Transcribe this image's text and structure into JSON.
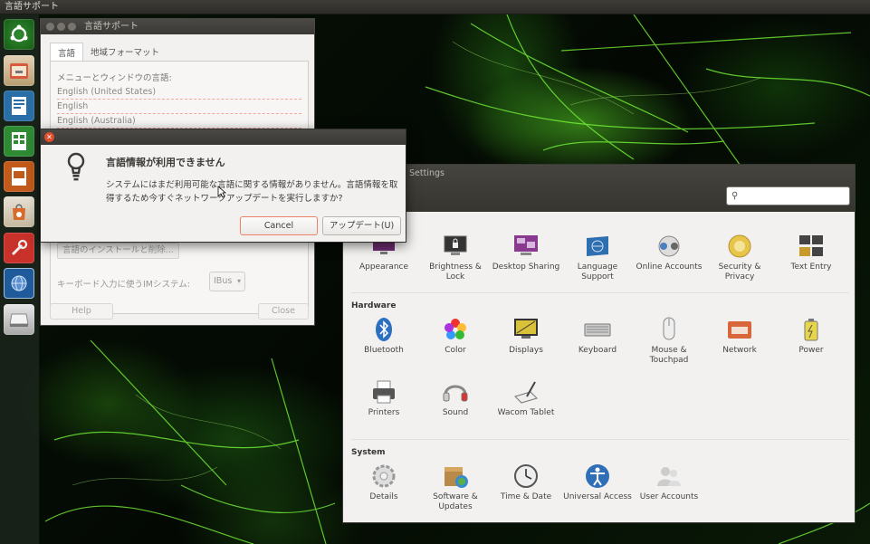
{
  "top_panel": {
    "title": "言語サポート"
  },
  "language_window": {
    "title": "言語サポート",
    "tabs": [
      {
        "label": "言語"
      },
      {
        "label": "地域フォーマット"
      }
    ],
    "menu_language_label": "メニューとウィンドウの言語:",
    "languages": [
      "English (United States)",
      "English",
      "English (Australia)"
    ],
    "install_button": "言語のインストールと削除...",
    "im_label": "キーボード入力に使うIMシステム:",
    "im_value": "IBus",
    "help_button": "Help",
    "close_button": "Close"
  },
  "dialog": {
    "heading": "言語情報が利用できません",
    "body": "システムにはまだ利用可能な言語に関する情報がありません。言語情報を取得するため今すぐネットワークアップデートを実行しますか?",
    "cancel_label": "Cancel",
    "update_label": "アップデート(U)"
  },
  "settings_window": {
    "title": "Settings",
    "search_placeholder": "",
    "personal_items": [
      {
        "label": "Appearance",
        "icon": "appearance-icon"
      },
      {
        "label": "Brightness & Lock",
        "icon": "brightness-lock-icon"
      },
      {
        "label": "Desktop Sharing",
        "icon": "desktop-sharing-icon"
      },
      {
        "label": "Language Support",
        "icon": "language-support-icon"
      },
      {
        "label": "Online Accounts",
        "icon": "online-accounts-icon"
      },
      {
        "label": "Security & Privacy",
        "icon": "security-privacy-icon"
      },
      {
        "label": "Text Entry",
        "icon": "text-entry-icon"
      }
    ],
    "hardware_title": "Hardware",
    "hardware_items": [
      {
        "label": "Bluetooth",
        "icon": "bluetooth-icon"
      },
      {
        "label": "Color",
        "icon": "color-icon"
      },
      {
        "label": "Displays",
        "icon": "displays-icon"
      },
      {
        "label": "Keyboard",
        "icon": "keyboard-icon"
      },
      {
        "label": "Mouse & Touchpad",
        "icon": "mouse-icon"
      },
      {
        "label": "Network",
        "icon": "network-icon"
      },
      {
        "label": "Power",
        "icon": "power-icon"
      },
      {
        "label": "Printers",
        "icon": "printer-icon"
      },
      {
        "label": "Sound",
        "icon": "sound-icon"
      },
      {
        "label": "Wacom Tablet",
        "icon": "wacom-tablet-icon"
      }
    ],
    "system_title": "System",
    "system_items": [
      {
        "label": "Details",
        "icon": "details-icon"
      },
      {
        "label": "Software & Updates",
        "icon": "software-updates-icon"
      },
      {
        "label": "Time & Date",
        "icon": "clock-icon"
      },
      {
        "label": "Universal Access",
        "icon": "universal-access-icon"
      },
      {
        "label": "User Accounts",
        "icon": "user-accounts-icon"
      }
    ]
  },
  "launcher": {
    "items": [
      {
        "icon": "ubuntu-dash-icon"
      },
      {
        "icon": "file-manager-icon"
      },
      {
        "icon": "libreoffice-writer-icon"
      },
      {
        "icon": "libreoffice-calc-icon"
      },
      {
        "icon": "libreoffice-impress-icon"
      },
      {
        "icon": "software-center-icon"
      },
      {
        "icon": "system-settings-icon"
      },
      {
        "icon": "language-support-icon"
      },
      {
        "icon": "drive-icon"
      }
    ]
  },
  "colors": {
    "accent_orange": "#e8836a",
    "close_red": "#e04d2a",
    "wallpaper_green": "#5adc28"
  }
}
